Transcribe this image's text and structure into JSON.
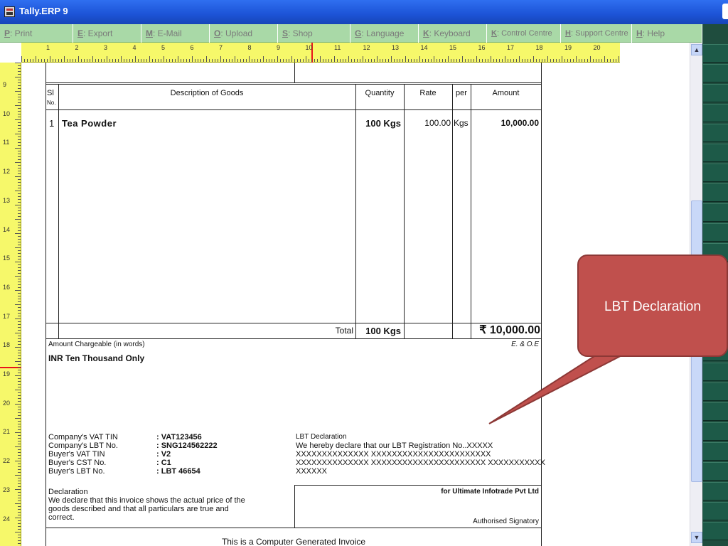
{
  "app": {
    "title": "Tally.ERP 9"
  },
  "menubar": {
    "items": [
      {
        "key": "P",
        "label": ": Print"
      },
      {
        "key": "E",
        "label": ": Export"
      },
      {
        "key": "M",
        "label": ": E-Mail"
      },
      {
        "key": "O",
        "label": ": Upload"
      },
      {
        "key": "S",
        "label": ": Shop"
      },
      {
        "key": "G",
        "label": ": Language"
      },
      {
        "key": "K",
        "label": ": Keyboard"
      },
      {
        "key": "K",
        "label": ": Control Centre"
      },
      {
        "key": "H",
        "label": ": Support Centre"
      },
      {
        "key": "H",
        "label": ": Help"
      }
    ]
  },
  "ruler": {
    "horizontal": [
      "1",
      "2",
      "3",
      "4",
      "5",
      "6",
      "7",
      "8",
      "9",
      "10",
      "11",
      "12",
      "13",
      "14",
      "15",
      "16",
      "17",
      "18",
      "19",
      "20"
    ],
    "vertical": [
      "9",
      "10",
      "11",
      "12",
      "13",
      "14",
      "15",
      "16",
      "17",
      "18",
      "19",
      "20",
      "21",
      "22",
      "23",
      "24"
    ]
  },
  "invoice": {
    "columns": {
      "sl": "Sl",
      "no": "No.",
      "description": "Description of Goods",
      "quantity": "Quantity",
      "rate": "Rate",
      "per": "per",
      "amount": "Amount"
    },
    "items": [
      {
        "sl": "1",
        "description": "Tea Powder",
        "quantity": "100 Kgs",
        "rate": "100.00",
        "per": "Kgs",
        "amount": "10,000.00"
      }
    ],
    "total": {
      "label": "Total",
      "quantity": "100 Kgs",
      "amount": "₹ 10,000.00"
    },
    "amount_words_label": "Amount Chargeable (in words)",
    "eoe": "E. & O.E",
    "amount_words": "INR Ten Thousand Only",
    "company_info": [
      {
        "label": "Company's VAT TIN",
        "value": ": VAT123456"
      },
      {
        "label": "Company's LBT No.",
        "value": ": SNG124562222"
      },
      {
        "label": "Buyer's VAT TIN",
        "value": ": V2"
      },
      {
        "label": "Buyer's CST No.",
        "value": ": C1"
      },
      {
        "label": "Buyer's LBT No.",
        "value": ": LBT 46654"
      }
    ],
    "lbt": {
      "title": "LBT Declaration",
      "lines": [
        "We hereby declare that our LBT Registration No..XXXXX",
        "XXXXXXXXXXXXXX XXXXXXXXXXXXXXXXXXXXXXX",
        "XXXXXXXXXXXXXX XXXXXXXXXXXXXXXXXXXXXX XXXXXXXXXXX",
        "XXXXXX"
      ]
    },
    "declaration": {
      "title": "Declaration",
      "lines": [
        "We declare that this invoice shows the actual price of the",
        "goods described and that all particulars are true and",
        "correct."
      ]
    },
    "for_company": "for Ultimate Infotrade Pvt Ltd",
    "signatory": "Authorised Signatory",
    "footer": "This is a Computer Generated Invoice"
  },
  "callout": {
    "text": "LBT Declaration",
    "color": "#c0504d"
  }
}
